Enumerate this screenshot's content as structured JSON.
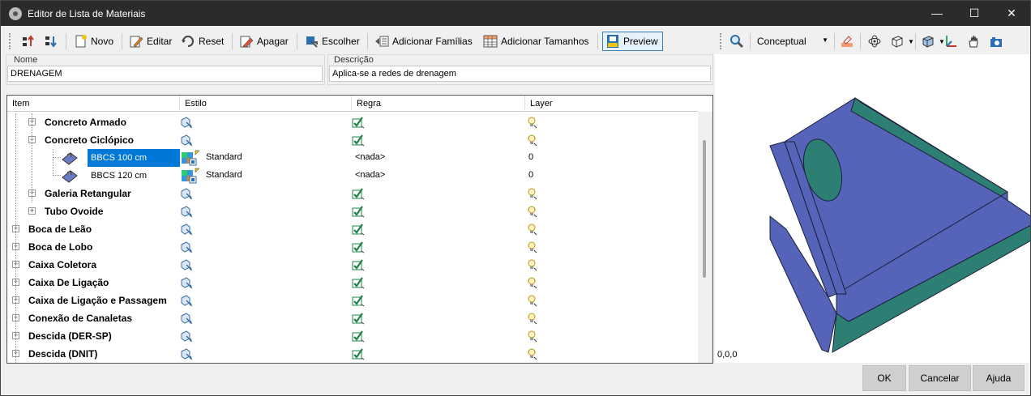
{
  "window": {
    "title": "Editor de Lista de Materiais",
    "minimize": "—",
    "maximize": "☐",
    "close": "✕"
  },
  "toolbar": {
    "novo": "Novo",
    "editar": "Editar",
    "reset": "Reset",
    "apagar": "Apagar",
    "escolher": "Escolher",
    "adicionar_familias": "Adicionar Famílias",
    "adicionar_tamanhos": "Adicionar Tamanhos",
    "preview": "Preview"
  },
  "preview_toolbar": {
    "visual_style": "Conceptual"
  },
  "form": {
    "nome_label": "Nome",
    "nome_value": "DRENAGEM",
    "descricao_label": "Descrição",
    "descricao_value": "Aplica-se a redes de drenagem"
  },
  "grid": {
    "columns": [
      "Item",
      "Estilo",
      "Regra",
      "Layer"
    ],
    "rows": [
      {
        "name": "Concreto Armado",
        "level": 1,
        "type": "group"
      },
      {
        "name": "Concreto Ciclópico",
        "level": 1,
        "type": "group",
        "expanded": true
      },
      {
        "name": "BBCS 100 cm",
        "level": 2,
        "type": "leaf",
        "selected": true,
        "style": "Standard",
        "rule": "<nada>",
        "layer": "0"
      },
      {
        "name": "BBCS 120 cm",
        "level": 2,
        "type": "leaf",
        "style": "Standard",
        "rule": "<nada>",
        "layer": "0"
      },
      {
        "name": "Galeria Retangular",
        "level": 1,
        "type": "group"
      },
      {
        "name": "Tubo Ovoide",
        "level": 1,
        "type": "group"
      },
      {
        "name": "Boca de Leão",
        "level": 0,
        "type": "group"
      },
      {
        "name": "Boca de Lobo",
        "level": 0,
        "type": "group"
      },
      {
        "name": "Caixa Coletora",
        "level": 0,
        "type": "group"
      },
      {
        "name": "Caixa De Ligação",
        "level": 0,
        "type": "group"
      },
      {
        "name": "Caixa de Ligação e Passagem",
        "level": 0,
        "type": "group"
      },
      {
        "name": "Conexão de Canaletas",
        "level": 0,
        "type": "group"
      },
      {
        "name": "Descida (DER-SP)",
        "level": 0,
        "type": "group"
      },
      {
        "name": "Descida (DNIT)",
        "level": 0,
        "type": "group"
      }
    ]
  },
  "preview": {
    "coords": "0,0,0",
    "colors": {
      "face": "#5563b8",
      "side": "#2e7f73",
      "edge": "#1a1f3a"
    }
  },
  "footer": {
    "ok": "OK",
    "cancelar": "Cancelar",
    "ajuda": "Ajuda"
  }
}
